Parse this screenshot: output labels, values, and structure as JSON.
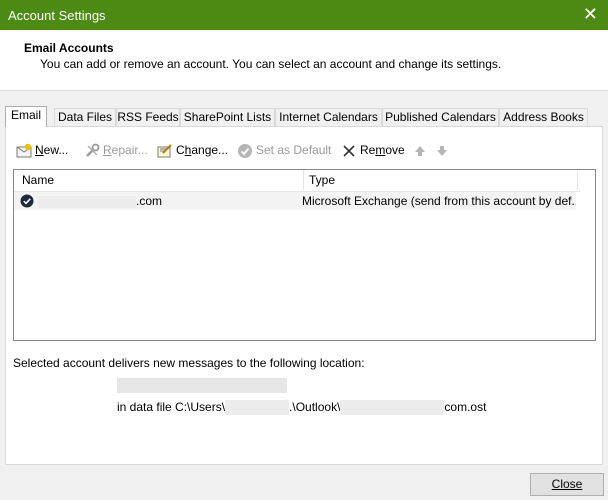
{
  "window": {
    "title": "Account Settings",
    "close_glyph": "✕"
  },
  "header": {
    "title": "Email Accounts",
    "subtitle": "You can add or remove an account. You can select an account and change its settings."
  },
  "tabs": [
    {
      "label": "Email",
      "active": true
    },
    {
      "label": "Data Files"
    },
    {
      "label": "RSS Feeds"
    },
    {
      "label": "SharePoint Lists"
    },
    {
      "label": "Internet Calendars"
    },
    {
      "label": "Published Calendars"
    },
    {
      "label": "Address Books"
    }
  ],
  "toolbar": {
    "new_mnemonic": "N",
    "new_rest": "ew...",
    "repair_mnemonic": "R",
    "repair_rest": "epair...",
    "change_prefix": "C",
    "change_mnemonic": "h",
    "change_rest": "ange...",
    "default_label": "Set as Default",
    "remove_prefix": "Re",
    "remove_mnemonic": "m",
    "remove_rest": "ove",
    "icons": [
      "new-account-icon",
      "repair-tools-icon",
      "change-account-icon",
      "set-default-check-icon",
      "remove-x-icon",
      "move-up-arrow-icon",
      "move-down-arrow-icon"
    ]
  },
  "accounts_table": {
    "columns": [
      "Name",
      "Type"
    ],
    "rows": [
      {
        "name_suffix": ".com",
        "type": "Microsoft Exchange (send from this account by def..."
      }
    ]
  },
  "delivery": {
    "label": "Selected account delivers new messages to the following location:",
    "path_prefix": "in data file C:\\Users\\",
    "path_mid": ".\\Outlook\\",
    "path_suffix": "com.ost"
  },
  "footer": {
    "close_label": "Close"
  },
  "colors": {
    "titlebar": "#4c8a13",
    "background": "#f0f0f0"
  }
}
